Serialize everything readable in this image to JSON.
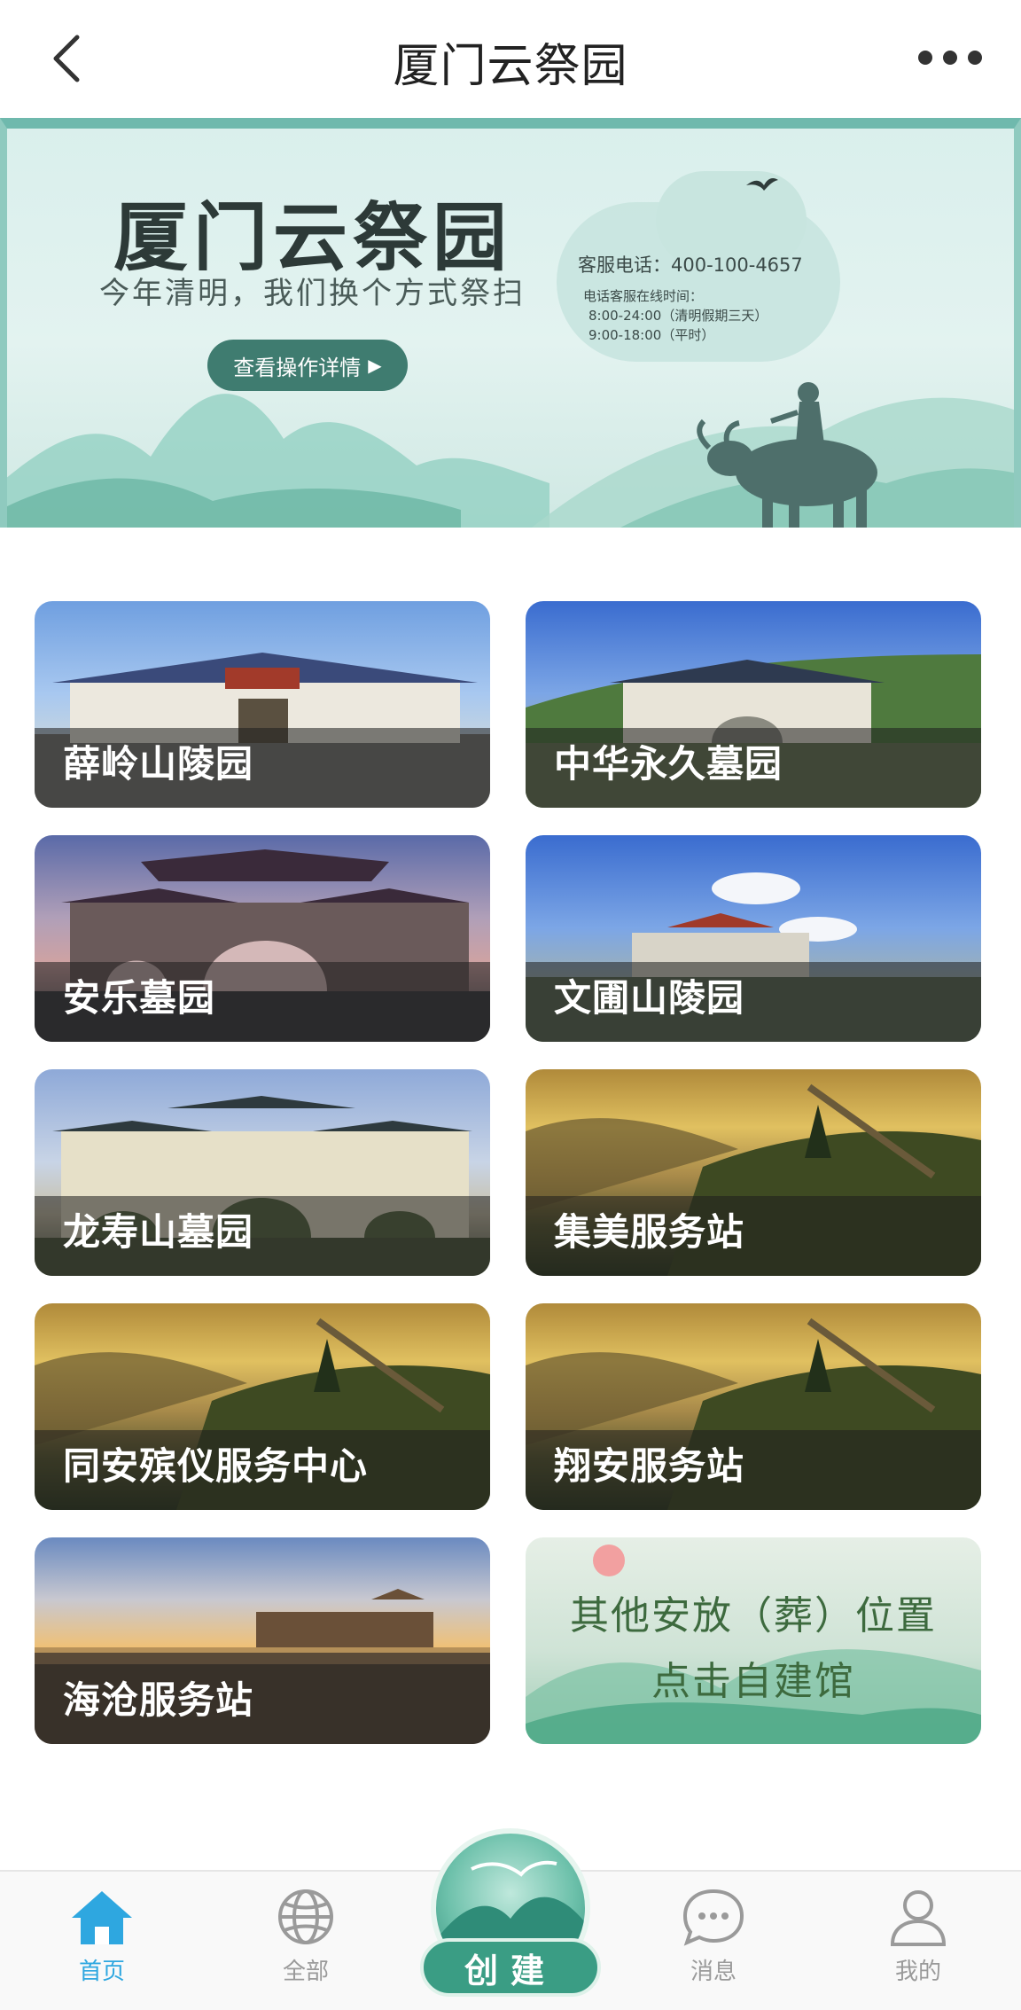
{
  "header": {
    "title": "厦门云祭园"
  },
  "banner": {
    "title": "厦门云祭园",
    "subtitle": "今年清明，我们换个方式祭扫",
    "button_label": "查看操作详情",
    "service_phone": "客服电话：400-100-4657",
    "service_hours_title": "电话客服在线时间：",
    "service_hours_qingming": "8:00-24:00（清明假期三天）",
    "service_hours_normal": "9:00-18:00（平时）"
  },
  "cemeteries": [
    {
      "label": "薛岭山陵园"
    },
    {
      "label": "中华永久墓园"
    },
    {
      "label": "安乐墓园"
    },
    {
      "label": "文圃山陵园"
    },
    {
      "label": "龙寿山墓园"
    },
    {
      "label": "集美服务站"
    },
    {
      "label": "同安殡仪服务中心"
    },
    {
      "label": "翔安服务站"
    },
    {
      "label": "海沧服务站"
    }
  ],
  "custom_card": {
    "line1": "其他安放（葬）位置",
    "line2": "点击自建馆"
  },
  "nav": {
    "home": "首页",
    "all": "全部",
    "create": "创建",
    "messages": "消息",
    "mine": "我的",
    "active_color": "#2ea7e0",
    "inactive_color": "#9a9a9a"
  }
}
